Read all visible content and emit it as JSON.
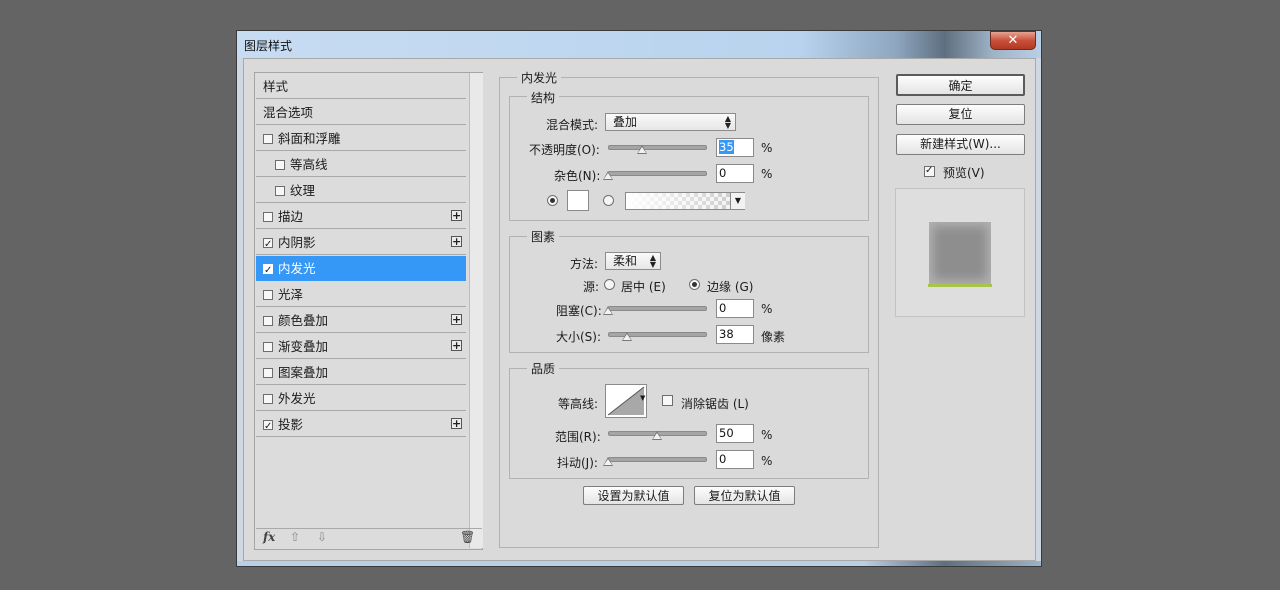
{
  "window": {
    "title": "图层样式",
    "close_glyph": "✕"
  },
  "styles_list": [
    {
      "label": "样式",
      "checkbox": false,
      "checked": false,
      "plus": false,
      "indent": 0,
      "selected": false
    },
    {
      "label": "混合选项",
      "checkbox": false,
      "checked": false,
      "plus": false,
      "indent": 0,
      "selected": false
    },
    {
      "label": "斜面和浮雕",
      "checkbox": true,
      "checked": false,
      "plus": false,
      "indent": 0,
      "selected": false
    },
    {
      "label": "等高线",
      "checkbox": true,
      "checked": false,
      "plus": false,
      "indent": 1,
      "selected": false
    },
    {
      "label": "纹理",
      "checkbox": true,
      "checked": false,
      "plus": false,
      "indent": 1,
      "selected": false
    },
    {
      "label": "描边",
      "checkbox": true,
      "checked": false,
      "plus": true,
      "indent": 0,
      "selected": false
    },
    {
      "label": "内阴影",
      "checkbox": true,
      "checked": true,
      "plus": true,
      "indent": 0,
      "selected": false
    },
    {
      "label": "内发光",
      "checkbox": true,
      "checked": true,
      "plus": false,
      "indent": 0,
      "selected": true
    },
    {
      "label": "光泽",
      "checkbox": true,
      "checked": false,
      "plus": false,
      "indent": 0,
      "selected": false
    },
    {
      "label": "颜色叠加",
      "checkbox": true,
      "checked": false,
      "plus": true,
      "indent": 0,
      "selected": false
    },
    {
      "label": "渐变叠加",
      "checkbox": true,
      "checked": false,
      "plus": true,
      "indent": 0,
      "selected": false
    },
    {
      "label": "图案叠加",
      "checkbox": true,
      "checked": false,
      "plus": false,
      "indent": 0,
      "selected": false
    },
    {
      "label": "外发光",
      "checkbox": true,
      "checked": false,
      "plus": false,
      "indent": 0,
      "selected": false
    },
    {
      "label": "投影",
      "checkbox": true,
      "checked": true,
      "plus": true,
      "indent": 0,
      "selected": false
    }
  ],
  "footer": {
    "fx": "fx",
    "up": "⇧",
    "down": "⇩",
    "trash": "🗑"
  },
  "panel": {
    "title": "内发光",
    "structure": {
      "title": "结构",
      "blend_mode_label": "混合模式:",
      "blend_mode_value": "叠加",
      "opacity_label": "不透明度(O):",
      "opacity_value": "35",
      "opacity_unit": "%",
      "opacity_level": 0.35,
      "noise_label": "杂色(N):",
      "noise_value": "0",
      "noise_unit": "%",
      "noise_level": 0
    },
    "elements": {
      "title": "图素",
      "method_label": "方法:",
      "method_value": "柔和",
      "source_label": "源:",
      "source_center": "居中 (E)",
      "source_edge": "边缘 (G)",
      "choke_label": "阻塞(C):",
      "choke_value": "0",
      "choke_unit": "%",
      "choke_level": 0,
      "size_label": "大小(S):",
      "size_value": "38",
      "size_unit": "像素",
      "size_level": 0.2
    },
    "quality": {
      "title": "品质",
      "contour_label": "等高线:",
      "antialias_label": "消除锯齿 (L)",
      "range_label": "范围(R):",
      "range_value": "50",
      "range_unit": "%",
      "range_level": 0.5,
      "jitter_label": "抖动(J):",
      "jitter_value": "0",
      "jitter_unit": "%",
      "jitter_level": 0
    },
    "set_default": "设置为默认值",
    "reset_default": "复位为默认值"
  },
  "right": {
    "ok": "确定",
    "reset": "复位",
    "new_style": "新建样式(W)...",
    "preview_label": "预览(V)",
    "preview_checked": true
  }
}
